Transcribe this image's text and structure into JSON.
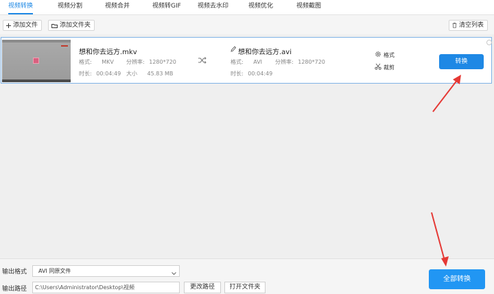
{
  "tabs": [
    {
      "label": "视频转换",
      "active": true
    },
    {
      "label": "视频分割"
    },
    {
      "label": "视频合并"
    },
    {
      "label": "视频转GIF"
    },
    {
      "label": "视频去水印"
    },
    {
      "label": "视频优化"
    },
    {
      "label": "视频截图"
    }
  ],
  "toolbar": {
    "add_file": "添加文件",
    "add_folder": "添加文件夹",
    "clear_list": "清空列表"
  },
  "file": {
    "source_name": "想和你去远方.mkv",
    "source_format_label": "格式:",
    "source_format": "MKV",
    "source_resolution_label": "分辨率:",
    "source_resolution": "1280*720",
    "source_duration_label": "时长:",
    "source_duration": "00:04:49",
    "source_size_label": "大小",
    "source_size": "45.83 MB",
    "target_name": "想和你去远方.avi",
    "target_format_label": "格式:",
    "target_format": "AVI",
    "target_resolution_label": "分辨率:",
    "target_resolution": "1280*720",
    "target_duration_label": "时长:",
    "target_duration": "00:04:49",
    "format_button": "格式",
    "cut_button": "裁剪",
    "convert_button": "转换"
  },
  "output": {
    "format_label": "输出格式",
    "format_value": "AVI  同原文件",
    "path_label": "输出路径",
    "path_value": "C:\\Users\\Administrator\\Desktop\\视频",
    "change_path": "更改路径",
    "open_folder": "打开文件夹",
    "convert_all": "全部转换"
  },
  "colors": {
    "accent": "#1e88e5",
    "annotation_arrow": "#e53935"
  }
}
